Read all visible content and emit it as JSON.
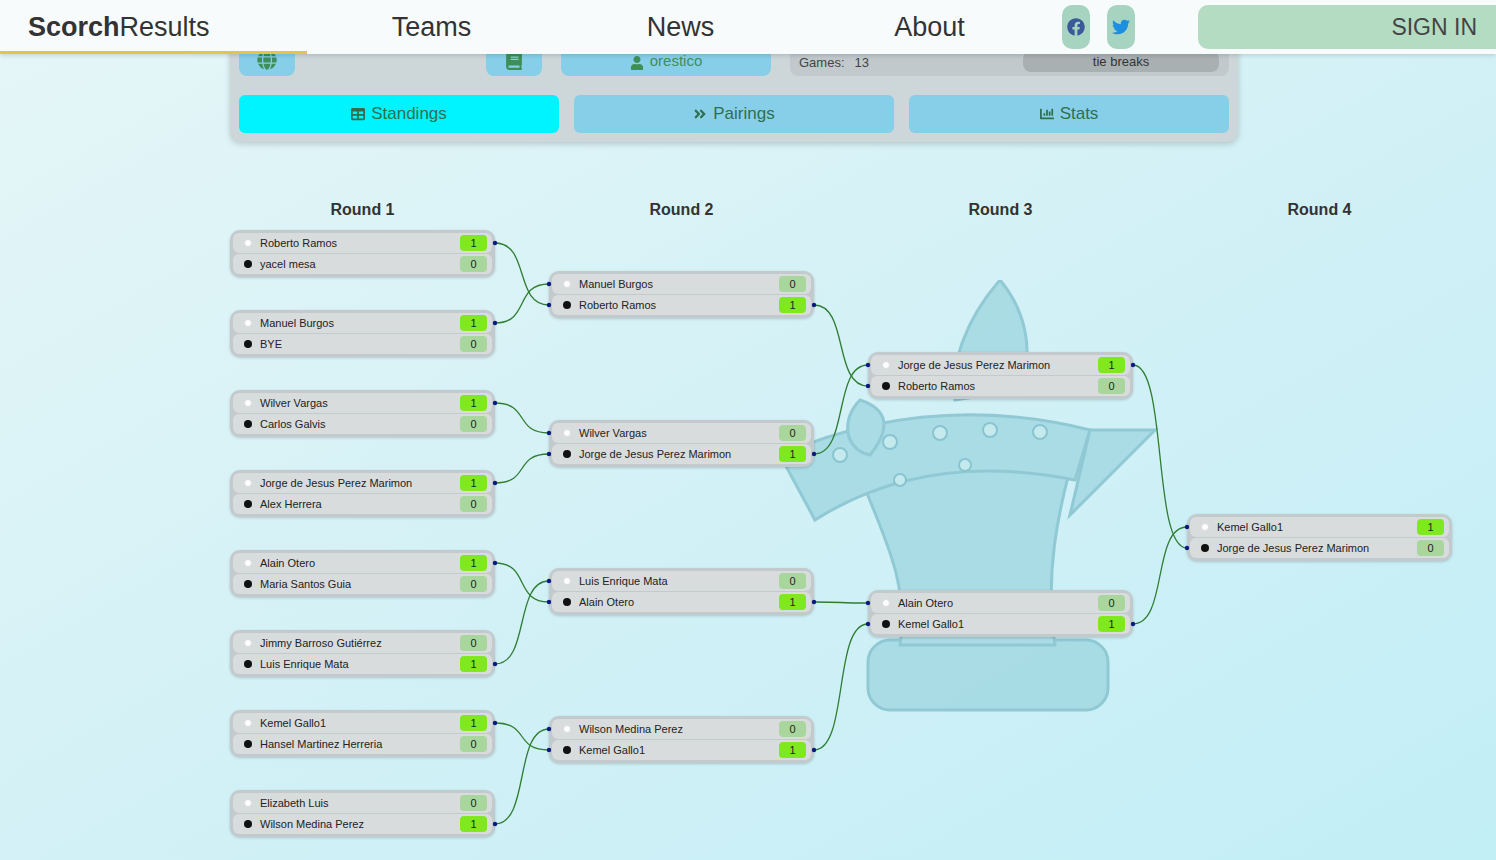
{
  "nav": {
    "logo_bold": "Scorch",
    "logo_rest": "Results",
    "links": [
      "Teams",
      "News",
      "About"
    ],
    "sign_in": "SIGN IN"
  },
  "event_bar": {
    "user": "orestico",
    "games_label": "Games:",
    "games": "13",
    "tie_breaks": "tie breaks"
  },
  "tabs": [
    {
      "label": "Standings",
      "selected": true
    },
    {
      "label": "Pairings",
      "selected": false
    },
    {
      "label": "Stats",
      "selected": false
    }
  ],
  "rounds": [
    {
      "title": "Round 1",
      "matches": [
        {
          "players": [
            {
              "name": "Roberto Ramos",
              "piece": "white",
              "score": "1",
              "winner": true
            },
            {
              "name": "yacel mesa",
              "piece": "black",
              "score": "0",
              "winner": false
            }
          ]
        },
        {
          "players": [
            {
              "name": "Manuel Burgos",
              "piece": "white",
              "score": "1",
              "winner": true
            },
            {
              "name": "BYE",
              "piece": "black",
              "score": "0",
              "winner": false
            }
          ]
        },
        {
          "players": [
            {
              "name": "Wilver Vargas",
              "piece": "white",
              "score": "1",
              "winner": true
            },
            {
              "name": "Carlos Galvis",
              "piece": "black",
              "score": "0",
              "winner": false
            }
          ]
        },
        {
          "players": [
            {
              "name": "Jorge de Jesus Perez Marimon",
              "piece": "white",
              "score": "1",
              "winner": true
            },
            {
              "name": "Alex Herrera",
              "piece": "black",
              "score": "0",
              "winner": false
            }
          ]
        },
        {
          "players": [
            {
              "name": "Alain Otero",
              "piece": "white",
              "score": "1",
              "winner": true
            },
            {
              "name": "Maria Santos Guia",
              "piece": "black",
              "score": "0",
              "winner": false
            }
          ]
        },
        {
          "players": [
            {
              "name": "Jimmy Barroso Gutiérrez",
              "piece": "white",
              "score": "0",
              "winner": false
            },
            {
              "name": "Luis Enrique Mata",
              "piece": "black",
              "score": "1",
              "winner": true
            }
          ]
        },
        {
          "players": [
            {
              "name": "Kemel Gallo1",
              "piece": "white",
              "score": "1",
              "winner": true
            },
            {
              "name": "Hansel Martinez Herreria",
              "piece": "black",
              "score": "0",
              "winner": false
            }
          ]
        },
        {
          "players": [
            {
              "name": "Elizabeth Luis",
              "piece": "white",
              "score": "0",
              "winner": false
            },
            {
              "name": "Wilson Medina Perez",
              "piece": "black",
              "score": "1",
              "winner": true
            }
          ]
        }
      ]
    },
    {
      "title": "Round 2",
      "matches": [
        {
          "players": [
            {
              "name": "Manuel Burgos",
              "piece": "white",
              "score": "0",
              "winner": false
            },
            {
              "name": "Roberto Ramos",
              "piece": "black",
              "score": "1",
              "winner": true
            }
          ]
        },
        {
          "players": [
            {
              "name": "Wilver Vargas",
              "piece": "white",
              "score": "0",
              "winner": false
            },
            {
              "name": "Jorge de Jesus Perez Marimon",
              "piece": "black",
              "score": "1",
              "winner": true
            }
          ]
        },
        {
          "players": [
            {
              "name": "Luis Enrique Mata",
              "piece": "white",
              "score": "0",
              "winner": false
            },
            {
              "name": "Alain Otero",
              "piece": "black",
              "score": "1",
              "winner": true
            }
          ]
        },
        {
          "players": [
            {
              "name": "Wilson Medina Perez",
              "piece": "white",
              "score": "0",
              "winner": false
            },
            {
              "name": "Kemel Gallo1",
              "piece": "black",
              "score": "1",
              "winner": true
            }
          ]
        }
      ]
    },
    {
      "title": "Round 3",
      "matches": [
        {
          "players": [
            {
              "name": "Jorge de Jesus Perez Marimon",
              "piece": "white",
              "score": "1",
              "winner": true
            },
            {
              "name": "Roberto Ramos",
              "piece": "black",
              "score": "0",
              "winner": false
            }
          ]
        },
        {
          "players": [
            {
              "name": "Alain Otero",
              "piece": "white",
              "score": "0",
              "winner": false
            },
            {
              "name": "Kemel Gallo1",
              "piece": "black",
              "score": "1",
              "winner": true
            }
          ]
        }
      ]
    },
    {
      "title": "Round 4",
      "matches": [
        {
          "players": [
            {
              "name": "Kemel Gallo1",
              "piece": "white",
              "score": "1",
              "winner": true
            },
            {
              "name": "Jorge de Jesus Perez Marimon",
              "piece": "black",
              "score": "0",
              "winner": false
            }
          ]
        }
      ]
    }
  ]
}
